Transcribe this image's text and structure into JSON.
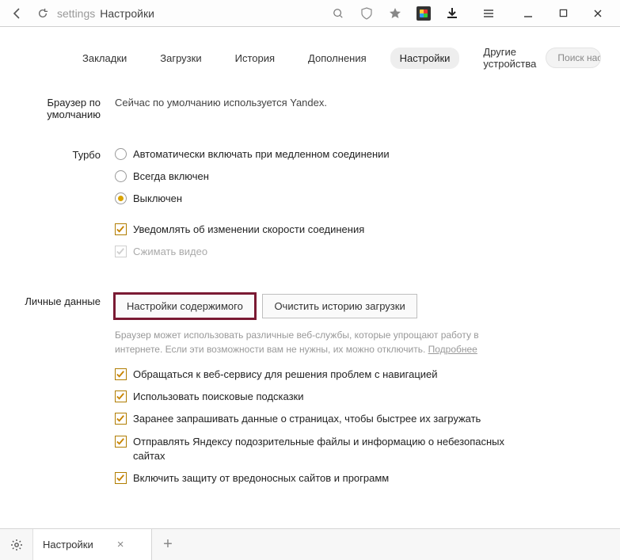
{
  "titlebar": {
    "scheme": "settings",
    "title": "Настройки"
  },
  "nav": {
    "tabs": [
      {
        "label": "Закладки"
      },
      {
        "label": "Загрузки"
      },
      {
        "label": "История"
      },
      {
        "label": "Дополнения"
      },
      {
        "label": "Настройки",
        "active": true
      },
      {
        "label": "Другие устройства"
      }
    ],
    "search_placeholder": "Поиск настроек"
  },
  "sections": {
    "default_browser": {
      "label": "Браузер по умолчанию",
      "status": "Сейчас по умолчанию используется Yandex."
    },
    "turbo": {
      "label": "Турбо",
      "radios": [
        {
          "label": "Автоматически включать при медленном соединении"
        },
        {
          "label": "Всегда включен"
        },
        {
          "label": "Выключен"
        }
      ],
      "checks": [
        {
          "label": "Уведомлять об изменении скорости соединения",
          "checked": true
        },
        {
          "label": "Сжимать видео",
          "checked": true,
          "disabled": true
        }
      ]
    },
    "personal": {
      "label": "Личные данные",
      "btn_content": "Настройки содержимого",
      "btn_clear": "Очистить историю загрузки",
      "hint_prefix": "Браузер может использовать различные веб-службы, которые упрощают работу в интернете. Если эти возможности вам не нужны, их можно отключить. ",
      "hint_link": "Подробнее",
      "checks": [
        {
          "label": "Обращаться к веб-сервису для решения проблем с навигацией",
          "checked": true
        },
        {
          "label": "Использовать поисковые подсказки",
          "checked": true
        },
        {
          "label": "Заранее запрашивать данные о страницах, чтобы быстрее их загружать",
          "checked": true
        },
        {
          "label": "Отправлять Яндексу подозрительные файлы и информацию о небезопасных сайтах",
          "checked": true
        },
        {
          "label": "Включить защиту от вредоносных сайтов и программ",
          "checked": true
        }
      ]
    }
  },
  "tabbar": {
    "tab_title": "Настройки"
  }
}
